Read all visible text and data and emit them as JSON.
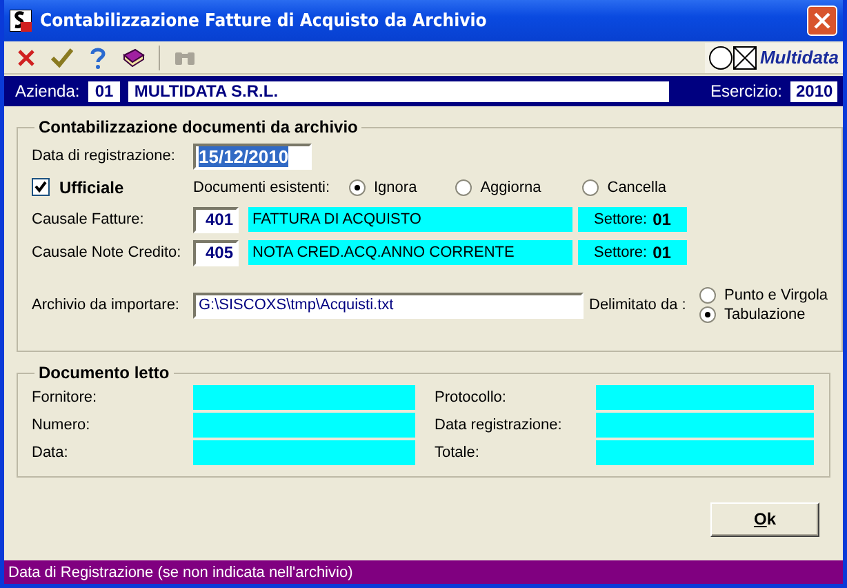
{
  "window": {
    "title": "Contabilizzazione Fatture di Acquisto da Archivio"
  },
  "toolbar": [
    {
      "kind": "cancel",
      "disabled": false
    },
    {
      "kind": "confirm",
      "disabled": false
    },
    {
      "kind": "help",
      "disabled": false
    },
    {
      "kind": "book",
      "disabled": false
    },
    {
      "kind": "binoculars",
      "disabled": true
    }
  ],
  "logo": "Multidata",
  "company": {
    "label": "Azienda:",
    "code": "01",
    "name": "MULTIDATA S.R.L.",
    "year_label": "Esercizio:",
    "year": "2010"
  },
  "import_group": {
    "title": "Contabilizzazione documenti da archivio",
    "date_label": "Data di registrazione:",
    "date": "15/12/2010",
    "date_highlighted": true,
    "official": {
      "label": "Ufficiale",
      "checked": true
    },
    "existing_label": "Documenti esistenti:",
    "existing_options": [
      {
        "label": "Ignora",
        "selected": true
      },
      {
        "label": "Aggiorna",
        "selected": false
      },
      {
        "label": "Cancella",
        "selected": false
      }
    ],
    "causals": [
      {
        "label": "Causale Fatture:",
        "code": "401",
        "description": "FATTURA DI ACQUISTO",
        "sector_label": "Settore:",
        "sector": "01"
      },
      {
        "label": "Causale Note Credito:",
        "code": "405",
        "description": "NOTA CRED.ACQ.ANNO CORRENTE",
        "sector_label": "Settore:",
        "sector": "01"
      }
    ],
    "file_label": "Archivio da importare:",
    "file": "G:\\SISCOXS\\tmp\\Acquisti.txt",
    "delimiter_label": "Delimitato da :",
    "delimiters": [
      {
        "label": "Punto e Virgola",
        "selected": false
      },
      {
        "label": "Tabulazione",
        "selected": true
      }
    ]
  },
  "document_group": {
    "title": "Documento letto",
    "fields": [
      {
        "label": "Fornitore:"
      },
      {
        "label": "Protocollo:"
      },
      {
        "label": "Numero:"
      },
      {
        "label": "Data registrazione:"
      },
      {
        "label": "Data:"
      },
      {
        "label": "Totale:"
      }
    ]
  },
  "ok_button": {
    "label": "Ok",
    "mnemonic_underlined": true
  },
  "status_bar": "Data di Registrazione (se non indicata nell'archivio)"
}
